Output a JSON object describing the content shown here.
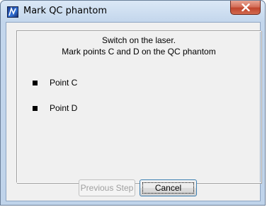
{
  "window": {
    "title": "Mark QC phantom",
    "app_icon": "app-logo-icon",
    "close_icon": "close-icon"
  },
  "instructions": {
    "line1": "Switch on the laser.",
    "line2": "Mark points C and D on the QC phantom"
  },
  "points": [
    {
      "label": "Point C"
    },
    {
      "label": "Point D"
    }
  ],
  "buttons": {
    "previous_label": "Previous Step",
    "previous_enabled": false,
    "cancel_label": "Cancel"
  },
  "colors": {
    "close_button": "#c0452d",
    "titlebar": "#c3d6ec",
    "dialog_body": "#f0f0f0"
  }
}
